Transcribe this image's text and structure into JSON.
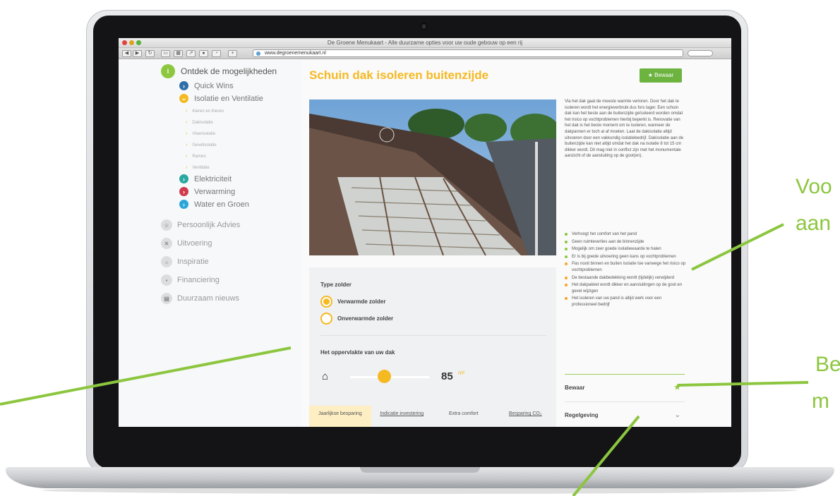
{
  "browser": {
    "window_title": "De Groene Menukaart - Alle duurzame opties voor uw oude gebouw op een rij",
    "url": "www.degroenemenukaart.nl"
  },
  "sidebar": {
    "main_section": "Ontdek de mogelijkheden",
    "sub_items": [
      {
        "label": "Quick Wins",
        "color": "#2e6fa8"
      },
      {
        "label": "Isolatie en Ventilatie",
        "color": "#f5b921"
      },
      {
        "label": "Elektriciteit",
        "color": "#2aa7a1"
      },
      {
        "label": "Verwarming",
        "color": "#d03a4c"
      },
      {
        "label": "Water en Groen",
        "color": "#2aa6d9"
      }
    ],
    "isolation_items": [
      "Kieren en Kieren",
      "Dakisolatie",
      "Vloerisolatie",
      "Gevelisolatie",
      "Ramen",
      "Ventilatie"
    ],
    "other_sections": [
      {
        "label": "Persoonlijk Advies",
        "icon": "person-icon"
      },
      {
        "label": "Uitvoering",
        "icon": "tools-icon"
      },
      {
        "label": "Inspiratie",
        "icon": "lightbulb-icon"
      },
      {
        "label": "Financiering",
        "icon": "money-icon"
      },
      {
        "label": "Duurzaam nieuws",
        "icon": "news-icon"
      }
    ]
  },
  "main": {
    "title": "Schuin dak isoleren buitenzijde",
    "save_button": "★ Bewaar",
    "description": "Via het dak gaat de meeste warmte verloren. Door het dak te isoleren wordt het energieverbruik dus fors lager. Een schuin dak kan het beste aan de buitenzijde geïsoleerd worden omdat het risico op vochtproblemen hierbij beperkt is. Renovatie van het dak is het beste moment om te isoleren, wanneer de dakpannen er toch al af moeten. Laat de dakisolatie altijd uitvoeren door een vakkundig isolatiebedrijf. Dakisolatie aan de buitenzijde kan niet altijd omdat het dak na isolatie 8 tot 15 cm dikker wordt. Dit mag niet in conflict zijn met het monumentale aanzicht of de aansluiting op de goot(en).",
    "bullets": [
      {
        "text": "Verhoogt het comfort van het pand",
        "type": "pro"
      },
      {
        "text": "Geen ruimteverlies aan de binnenzijde",
        "type": "pro"
      },
      {
        "text": "Mogelijk om zeer goede isolatiewaarde te halen",
        "type": "pro"
      },
      {
        "text": "Er is bij goede uitvoering geen kans op vochtproblemen",
        "type": "pro"
      },
      {
        "text": "Pas nooit binnen en buiten isolatie toe vanwege het risico op vochtproblemen",
        "type": "con"
      },
      {
        "text": "De bestaande dakbedekking wordt (tijdelijk) verwijderd",
        "type": "con"
      },
      {
        "text": "Het dakpakket wordt dikker en aansluitingen op de goot en gevel wijzigen",
        "type": "con"
      },
      {
        "text": "Het isoleren van uw pand is altijd werk voor een professioneel bedrijf",
        "type": "con"
      }
    ],
    "bullet_colors": {
      "pro": "#8dc63f",
      "con": "#f5a623"
    },
    "accordion": [
      {
        "label": "Bewaar",
        "icon": "star-icon"
      },
      {
        "label": "Regelgeving",
        "icon": "chevron-down-icon"
      }
    ]
  },
  "form": {
    "attic_type_label": "Type zolder",
    "options": [
      "Verwarmde zolder",
      "Onverwarmde zolder"
    ],
    "selected_option": 0,
    "roof_area_label": "Het oppervlakte van uw dak",
    "roof_area_value": "85",
    "roof_area_unit": "m²",
    "tabs": [
      {
        "label": "Jaarlijkse besparing",
        "active": true
      },
      {
        "label": "Indicatie investering",
        "active": false
      },
      {
        "label": "Extra comfort",
        "active": false
      },
      {
        "label": "Besparing CO₂",
        "active": false
      }
    ]
  },
  "callouts": [
    "Voo",
    "aan",
    "Be",
    "m"
  ],
  "colors": {
    "accent_yellow": "#f5b921",
    "accent_green": "#8dc63f",
    "save_green": "#6cb33f"
  }
}
